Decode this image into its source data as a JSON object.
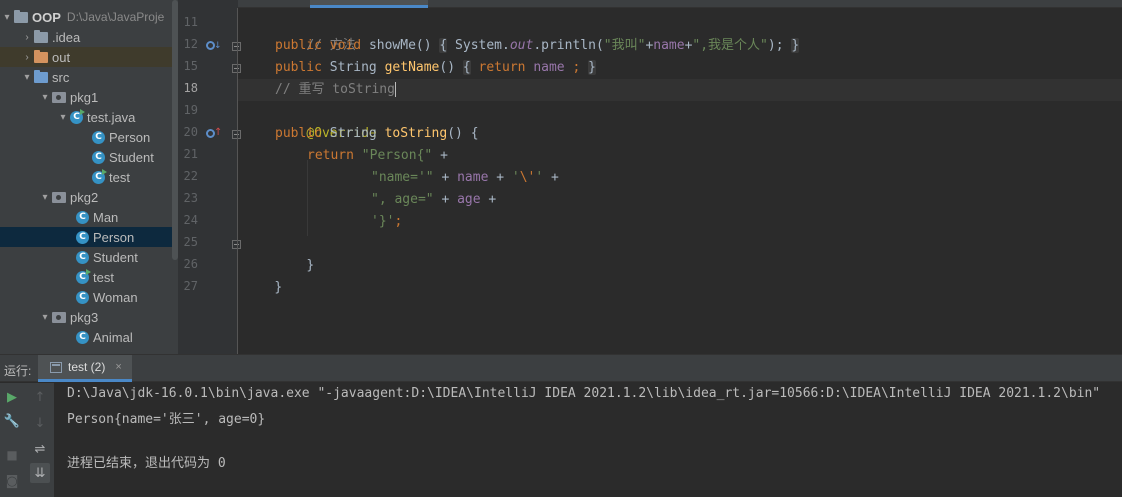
{
  "project_tree": {
    "root": {
      "label": "OOP",
      "path": "D:\\Java\\JavaProje"
    },
    "items": [
      {
        "label": ".idea"
      },
      {
        "label": "out"
      },
      {
        "label": "src"
      },
      {
        "label": "pkg1"
      },
      {
        "label": "test.java"
      },
      {
        "label": "Person"
      },
      {
        "label": "Student"
      },
      {
        "label": "test"
      },
      {
        "label": "pkg2"
      },
      {
        "label": "Man"
      },
      {
        "label": "Person"
      },
      {
        "label": "Student"
      },
      {
        "label": "test"
      },
      {
        "label": "Woman"
      },
      {
        "label": "pkg3"
      },
      {
        "label": "Animal"
      }
    ]
  },
  "editor": {
    "line_numbers": [
      "11",
      "12",
      "15",
      "18",
      "19",
      "20",
      "21",
      "22",
      "23",
      "24",
      "25",
      "26",
      "27"
    ],
    "current_line": "18",
    "lines": {
      "l11": {
        "comment": "// 方法"
      },
      "l12": {
        "kw1": "public",
        "kw2": "void",
        "name": "showMe",
        "paren": "()",
        "obrace": "{",
        "sys": "System.",
        "out": "out",
        "println": ".println(",
        "s1": "\"我叫\"",
        "plus1": "+",
        "field": "name",
        "plus2": "+",
        "s2": "\",我是个人\"",
        "tail": ");",
        "cbrace": "}"
      },
      "l15": {
        "kw1": "public",
        "type": "String",
        "name": "getName",
        "paren": "()",
        "obrace": "{",
        "ret": "return",
        "field": "name",
        "semi": ";",
        "cbrace": "}"
      },
      "l18": {
        "comment": "// 重写 toString"
      },
      "l19": {
        "annotation": "@Override"
      },
      "l20": {
        "kw1": "public",
        "type": "String",
        "name": "toString",
        "rest": "() {"
      },
      "l21": {
        "ret": "return",
        "str": "\"Person{\"",
        "plus": " +"
      },
      "l22": {
        "str": "\"name='\"",
        "plus1": " + ",
        "field": "name",
        "plus2": " + ",
        "q1": "'",
        "esc": "\\'",
        "q2": "'",
        "plus3": " +"
      },
      "l23": {
        "str": "\", age=\"",
        "plus1": " + ",
        "field": "age",
        "plus2": " +"
      },
      "l24": {
        "q1": "'",
        "ch": "}",
        "q2": "'",
        "semi": ";"
      },
      "l25": {
        "brace": "}"
      },
      "l26": {
        "brace": "}"
      }
    }
  },
  "run_panel": {
    "title": "运行:",
    "tab_label": "test (2)",
    "tab_close": "×",
    "console_lines": [
      "D:\\Java\\jdk-16.0.1\\bin\\java.exe \"-javaagent:D:\\IDEA\\IntelliJ IDEA 2021.1.2\\lib\\idea_rt.jar=10566:D:\\IDEA\\IntelliJ IDEA 2021.1.2\\bin\"",
      "Person{name='张三', age=0}",
      "",
      "进程已结束，退出代码为 0"
    ]
  },
  "colors": {
    "keyword": "#cc7832",
    "string": "#6a8759",
    "method": "#ffc66d",
    "field": "#9876aa",
    "comment": "#808080",
    "annotation": "#bbb529",
    "accent": "#4a88c7"
  }
}
